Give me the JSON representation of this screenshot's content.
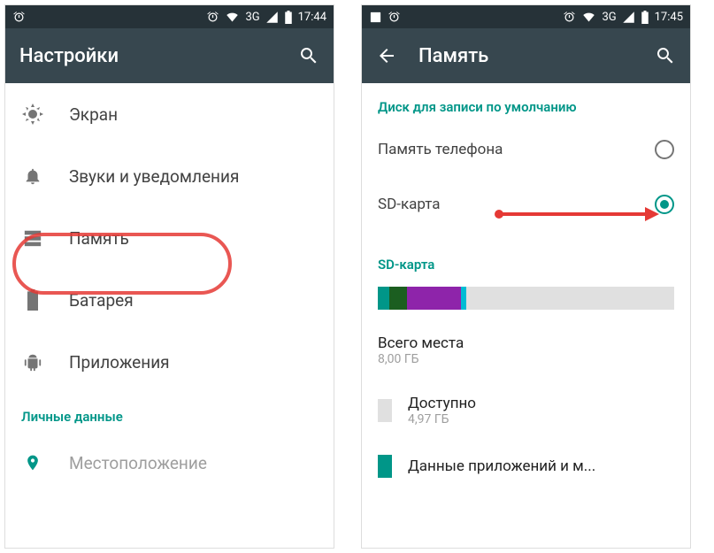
{
  "screen1": {
    "statusbar": {
      "time": "17:44",
      "network": "3G"
    },
    "appbar": {
      "title": "Настройки"
    },
    "items": [
      {
        "label": "Экран"
      },
      {
        "label": "Звуки и уведомления"
      },
      {
        "label": "Память"
      },
      {
        "label": "Батарея"
      },
      {
        "label": "Приложения"
      }
    ],
    "section_personal": {
      "title": "Личные данные"
    },
    "items_personal": [
      {
        "label": "Местоположение"
      }
    ]
  },
  "screen2": {
    "statusbar": {
      "time": "17:45",
      "network": "3G"
    },
    "appbar": {
      "title": "Память"
    },
    "section_default": {
      "title": "Диск для записи по умолчанию"
    },
    "radios": [
      {
        "label": "Память телефона"
      },
      {
        "label": "SD-карта"
      }
    ],
    "section_sd": {
      "title": "SD-карта"
    },
    "storage_segments": [
      {
        "color": "#009688",
        "width": 4
      },
      {
        "color": "#1b5e20",
        "width": 6
      },
      {
        "color": "#8e24aa",
        "width": 18
      },
      {
        "color": "#00bcd4",
        "width": 2
      }
    ],
    "storage_items": [
      {
        "swatch": "none",
        "title": "Всего места",
        "sub": "8,00 ГБ"
      },
      {
        "swatch": "#e0e0e0",
        "title": "Доступно",
        "sub": "4,97 ГБ"
      },
      {
        "swatch": "#009688",
        "title": "Данные приложений и м...",
        "sub": ""
      }
    ]
  }
}
